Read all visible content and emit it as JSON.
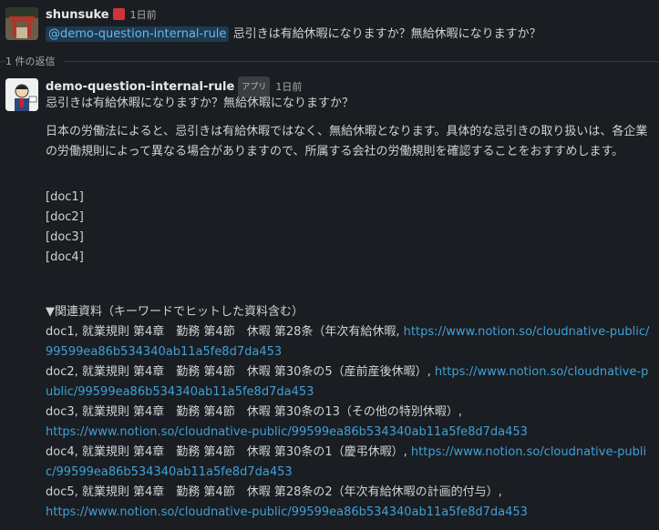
{
  "parent": {
    "user": "shunsuke",
    "time": "1日前",
    "mention": "@demo-question-internal-rule",
    "text": "忌引きは有給休暇になりますか？無給休暇になりますか？"
  },
  "replies_count": "1 件の返信",
  "reply": {
    "user": "demo-question-internal-rule",
    "app_badge": "アプリ",
    "time": "1日前",
    "question": "忌引きは有給休暇になりますか？無給休暇になりますか？",
    "answer": "日本の労働法によると、忌引きは有給休暇ではなく、無給休暇となります。具体的な忌引きの取り扱いは、各企業の労働規則によって異なる場合がありますので、所属する会社の労働規則を確認することをおすすめします。",
    "docs": [
      "[doc1]",
      "[doc2]",
      "[doc3]",
      "[doc4]"
    ],
    "related_header": "▼関連資料（キーワードでヒットした資料含む）",
    "refs": [
      {
        "title": "doc1, 就業規則 第4章　勤務 第4節　休暇 第28条（年次有給休暇, ",
        "link": "https://www.notion.so/cloudnative-public/99599ea86b534340ab11a5fe8d7da453"
      },
      {
        "title": "doc2, 就業規則 第4章　勤務 第4節　休暇 第30条の5（産前産後休暇）, ",
        "link": "https://www.notion.so/cloudnative-public/99599ea86b534340ab11a5fe8d7da453"
      },
      {
        "title": "doc3, 就業規則 第4章　勤務 第4節　休暇 第30条の13（その他の特別休暇）,",
        "link": "https://www.notion.so/cloudnative-public/99599ea86b534340ab11a5fe8d7da453"
      },
      {
        "title": "doc4, 就業規則 第4章　勤務 第4節　休暇 第30条の1（慶弔休暇）, ",
        "link": "https://www.notion.so/cloudnative-public/99599ea86b534340ab11a5fe8d7da453"
      },
      {
        "title": "doc5, 就業規則 第4章　勤務 第4節　休暇 第28条の2（年次有給休暇の計画的付与）,",
        "link": "https://www.notion.so/cloudnative-public/99599ea86b534340ab11a5fe8d7da453"
      }
    ]
  }
}
